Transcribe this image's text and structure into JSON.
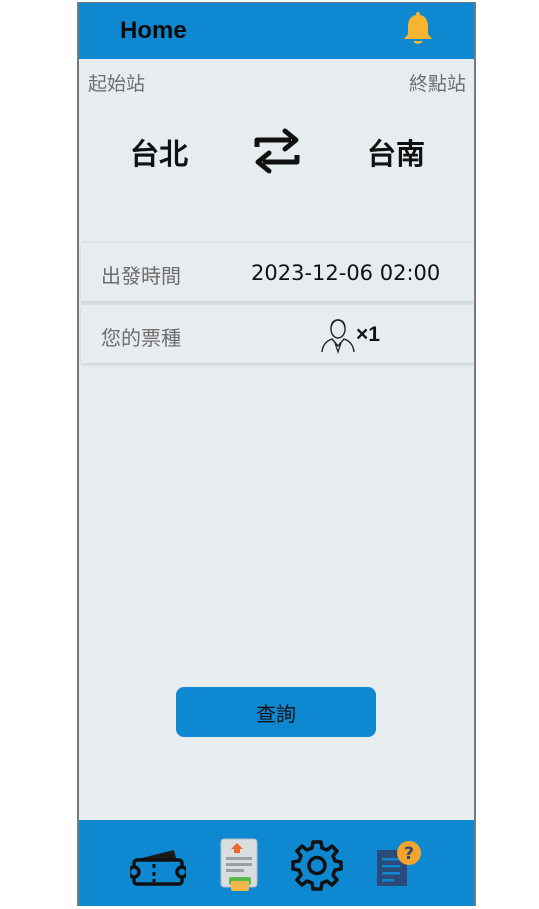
{
  "header": {
    "title": "Home",
    "notification_icon": "bell-icon"
  },
  "route": {
    "from_label": "起始站",
    "to_label": "終點站",
    "from_station": "台北",
    "to_station": "台南",
    "swap_icon": "swap-arrows-icon"
  },
  "departure": {
    "label": "出發時間",
    "value": "2023-12-06 02:00"
  },
  "ticket": {
    "label": "您的票種",
    "icon": "person-icon",
    "count": "×1"
  },
  "search_button": {
    "label": "查詢"
  },
  "tabbar": {
    "items": [
      {
        "icon": "ticket-icon"
      },
      {
        "icon": "receipt-icon"
      },
      {
        "icon": "gear-icon"
      },
      {
        "icon": "help-document-icon"
      }
    ]
  },
  "colors": {
    "primary": "#0e88d1",
    "background": "#e7ecef",
    "bell": "#f6b431",
    "help_badge": "#f4a42a",
    "document": "#2b4a7a"
  }
}
